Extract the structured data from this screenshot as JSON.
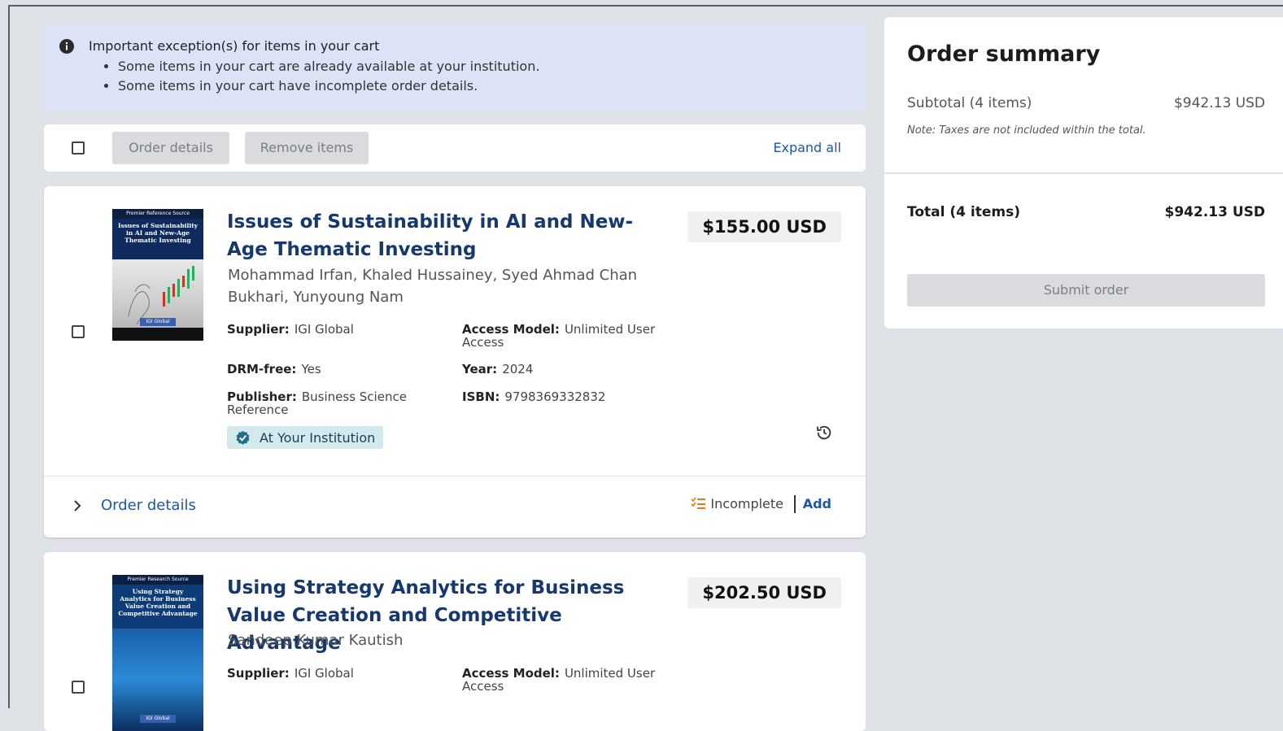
{
  "alert": {
    "title": "Important exception(s) for items in your cart",
    "messages": [
      "Some items in your cart are already available at your institution.",
      "Some items in your cart have incomplete order details."
    ]
  },
  "toolbar": {
    "order_details_label": "Order details",
    "remove_items_label": "Remove items",
    "expand_all_label": "Expand all"
  },
  "items": [
    {
      "cover_series": "Premier Reference Source",
      "cover_title": "Issues of Sustainability in AI and New-Age Thematic Investing",
      "title": "Issues of Sustainability in AI and New-Age Thematic Investing",
      "authors": "Mohammad Irfan, Khaled Hussainey, Syed Ahmad Chan Bukhari, Yunyoung Nam",
      "price": "$155.00 USD",
      "supplier_label": "Supplier:",
      "supplier": "IGI Global",
      "access_model_label": "Access Model:",
      "access_model": "Unlimited User Access",
      "drm_label": "DRM-free:",
      "drm": "Yes",
      "year_label": "Year:",
      "year": "2024",
      "publisher_label": "Publisher:",
      "publisher": "Business Science Reference",
      "isbn_label": "ISBN:",
      "isbn": "9798369332832",
      "badge": "At Your Institution",
      "order_details_link": "Order details",
      "status": "Incomplete",
      "add_label": "Add"
    },
    {
      "cover_series": "Premier Research Source",
      "cover_title": "Using Strategy Analytics for Business Value Creation and Competitive Advantage",
      "title": "Using Strategy Analytics for Business Value Creation and Competitive Advantage",
      "authors": "Sandeep Kumar Kautish",
      "price": "$202.50 USD",
      "supplier_label": "Supplier:",
      "supplier": "IGI Global",
      "access_model_label": "Access Model:",
      "access_model": "Unlimited User Access"
    }
  ],
  "summary": {
    "title": "Order summary",
    "subtotal_label": "Subtotal (4 items)",
    "subtotal_value": "$942.13 USD",
    "note": "Note: Taxes are not included within the total.",
    "total_label": "Total (4 items)",
    "total_value": "$942.13 USD",
    "submit_label": "Submit order"
  },
  "colors": {
    "link": "#1f56a6",
    "title": "#16386e",
    "alert_bg": "#dde3f6",
    "badge_bg": "#d3e9ee",
    "incomplete_icon": "#e07b1a"
  }
}
